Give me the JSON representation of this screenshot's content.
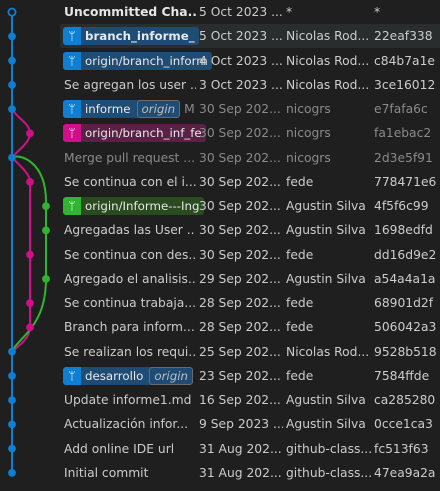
{
  "colors": {
    "background": "#1f1f1f",
    "main_lane": "#0e7fd2",
    "pink_lane": "#d10f8a",
    "green_lane": "#2fb52f"
  },
  "icons": {
    "branch": "git-branch-icon"
  },
  "commits": [
    {
      "description": "Uncommitted Cha...",
      "date": "5 Oct 2023 ...",
      "author": "*",
      "hash": "*",
      "style": "bold"
    },
    {
      "tags": [
        {
          "label": "branch_informe_",
          "color": "blue",
          "bold": true
        }
      ],
      "date": "5 Oct 2023 ...",
      "author": "Nicolas Rod...",
      "hash": "22eaf338",
      "style": "normal",
      "selected": true
    },
    {
      "tags": [
        {
          "label": "origin/branch_inform",
          "color": "blue"
        }
      ],
      "date": "4 Oct 2023 ...",
      "author": "Nicolas Rod...",
      "hash": "c84b7a1e",
      "style": "normal"
    },
    {
      "description": "Se agregan los user ...",
      "date": "3 Oct 2023 ...",
      "author": "Nicolas Rod...",
      "hash": "3ce16012",
      "style": "normal"
    },
    {
      "tags": [
        {
          "label": "informe",
          "color": "blue",
          "sub": "origin"
        }
      ],
      "trail": "M",
      "date": "30 Sep 202...",
      "author": "nicogrs",
      "hash": "e7fafa6c",
      "style": "dim"
    },
    {
      "tags": [
        {
          "label": "origin/branch_inf_fe",
          "color": "pink"
        }
      ],
      "date": "30 Sep 202...",
      "author": "nicogrs",
      "hash": "fa1ebac2",
      "style": "dim"
    },
    {
      "description": "Merge pull request ...",
      "date": "30 Sep 202...",
      "author": "nicogrs",
      "hash": "2d3e5f91",
      "style": "dim"
    },
    {
      "description": "Se continua con el i...",
      "date": "30 Sep 202...",
      "author": "fede",
      "hash": "778471e6",
      "style": "normal"
    },
    {
      "tags": [
        {
          "label": "origin/Informe---Ing",
          "color": "green"
        }
      ],
      "date": "30 Sep 202...",
      "author": "Agustin Silva",
      "hash": "4f5f6c99",
      "style": "normal"
    },
    {
      "description": "Agregadas las User ...",
      "date": "30 Sep 202...",
      "author": "Agustin Silva",
      "hash": "1698edfd",
      "style": "normal"
    },
    {
      "description": "Se continua con des...",
      "date": "30 Sep 202...",
      "author": "fede",
      "hash": "dd16d9e2",
      "style": "normal"
    },
    {
      "description": "Agregado el analisis...",
      "date": "29 Sep 202...",
      "author": "Agustin Silva",
      "hash": "a54a4a1a",
      "style": "normal"
    },
    {
      "description": "Se continua trabaja...",
      "date": "28 Sep 202...",
      "author": "fede",
      "hash": "68901d2f",
      "style": "normal"
    },
    {
      "description": "Branch para inform...",
      "date": "28 Sep 202...",
      "author": "fede",
      "hash": "506042a3",
      "style": "normal"
    },
    {
      "description": "Se realizan los requi...",
      "date": "25 Sep 202...",
      "author": "Nicolas Rod...",
      "hash": "9528b518",
      "style": "normal"
    },
    {
      "tags": [
        {
          "label": "desarrollo",
          "color": "blue",
          "sub": "origin"
        }
      ],
      "date": "23 Sep 202...",
      "author": "fede",
      "hash": "7584ffde",
      "style": "normal"
    },
    {
      "description": "Update informe1.md",
      "date": "16 Sep 202...",
      "author": "Agustin Silva",
      "hash": "ca285280",
      "style": "normal"
    },
    {
      "description": "Actualización infor...",
      "date": "9 Sep 2023 ...",
      "author": "Agustin Silva",
      "hash": "0cce1ca3",
      "style": "normal"
    },
    {
      "description": "Add online IDE url",
      "date": "31 Aug 202...",
      "author": "github-class...",
      "hash": "fc513f63",
      "style": "normal"
    },
    {
      "description": "Initial commit",
      "date": "31 Aug 202...",
      "author": "github-class...",
      "hash": "47ea9a2a",
      "style": "normal"
    }
  ]
}
